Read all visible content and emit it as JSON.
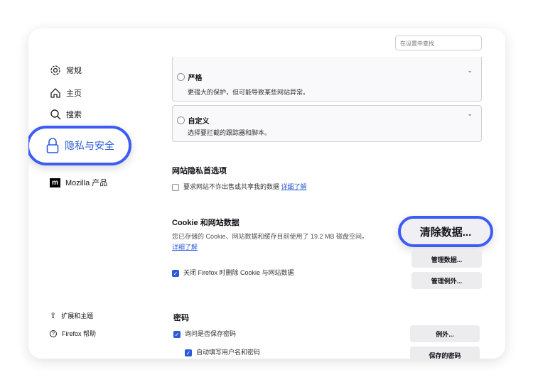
{
  "search": {
    "placeholder": "在设置中查找"
  },
  "sidebar": {
    "items": [
      {
        "label": "常规",
        "icon": "gear-icon"
      },
      {
        "label": "主页",
        "icon": "home-icon"
      },
      {
        "label": "搜索",
        "icon": "search-icon"
      },
      {
        "label": "隐私与安全",
        "icon": "lock-icon",
        "active": true
      },
      {
        "label": "Mozilla 产品",
        "icon": "mozilla-icon"
      }
    ],
    "footer": [
      {
        "label": "扩展和主题",
        "icon": "puzzle-icon"
      },
      {
        "label": "Firefox 帮助",
        "icon": "help-icon"
      }
    ]
  },
  "tracking": {
    "strict": {
      "title": "严格",
      "desc": "更强大的保护，但可能导致某些网站异常。"
    },
    "custom": {
      "title": "自定义",
      "desc": "选择要拦截的跟踪器和脚本。"
    }
  },
  "privacy_prefs": {
    "heading": "网站隐私首选项",
    "checkbox": "要求网站不许出售或共享我的数据",
    "link": "详细了解"
  },
  "cookies": {
    "heading": "Cookie 和网站数据",
    "desc": "您已存储的 Cookie、网站数据和缓存目前使用了 19.2 MB 磁盘空间。",
    "link": "详细了解",
    "checkbox": "关闭 Firefox 时删除 Cookie 与网站数据",
    "clear": "清除数据...",
    "manage": "管理数据...",
    "exceptions": "管理例外..."
  },
  "passwords": {
    "heading": "密码",
    "ask": "询问是否保存密码",
    "autofill": "自动填写用户名和密码",
    "exceptions": "例外...",
    "saved": "保存的密码"
  },
  "colors": {
    "accent": "#2b5bd8",
    "highlight": "#3d5cf5"
  }
}
